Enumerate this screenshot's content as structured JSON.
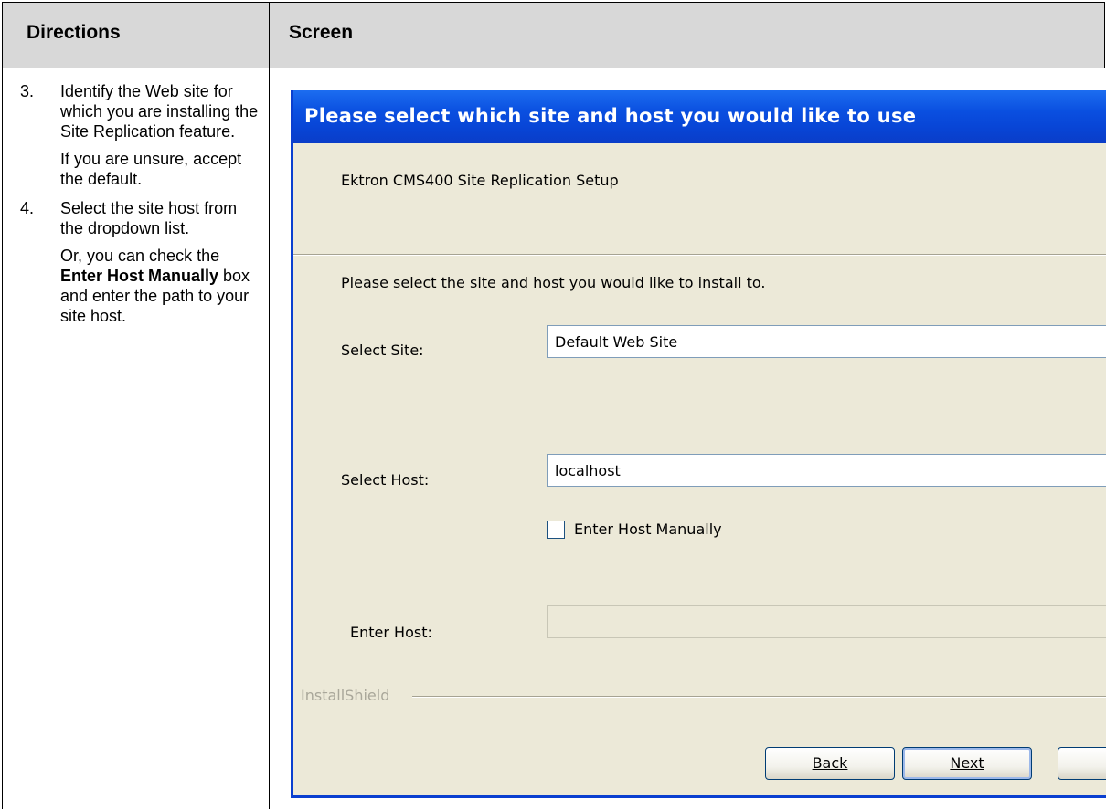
{
  "table": {
    "col1_header": "Directions",
    "col2_header": "Screen"
  },
  "steps": [
    {
      "num": "3.",
      "paragraphs": [
        "Identify the Web site for which you are installing the Site Replication feature.",
        "If you are unsure, accept the default."
      ]
    },
    {
      "num": "4.",
      "para1": "Select the site host from the dropdown list.",
      "para2_pre": "Or, you can check the ",
      "para2_bold": "Enter Host Manually",
      "para2_post": " box and enter the path to your site host."
    }
  ],
  "dialog": {
    "title": "Please select which site and host you would like to use",
    "subtitle": "Ektron CMS400 Site Replication Setup",
    "instruction": "Please select the site and host you would like to install to.",
    "select_site_label": "Select Site:",
    "select_site_value": "Default Web Site",
    "select_host_label": "Select Host:",
    "select_host_value": "localhost",
    "checkbox_label": "Enter Host Manually",
    "checkbox_checked": false,
    "enter_host_label": "Enter Host:",
    "enter_host_value": "",
    "branding": "InstallShield",
    "buttons": {
      "back": "Back",
      "next": "Next"
    }
  }
}
